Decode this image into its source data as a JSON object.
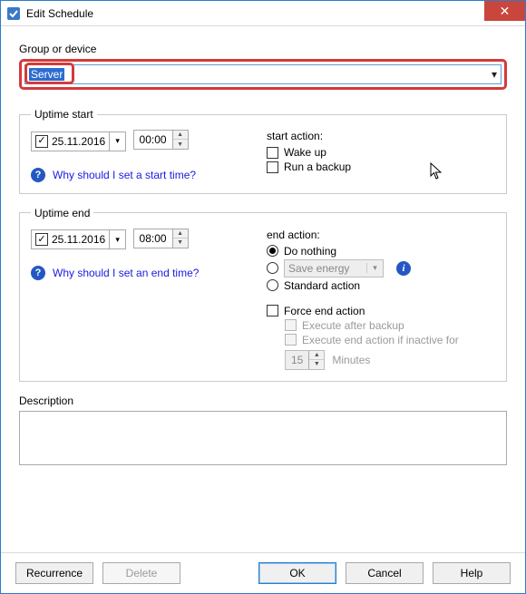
{
  "window": {
    "title": "Edit Schedule"
  },
  "groupdevice": {
    "label": "Group or device",
    "value": "Server"
  },
  "uptime_start": {
    "label": "Uptime start",
    "date": "25.11.2016",
    "time": "00:00",
    "date_enabled": true,
    "help": "Why should I set a start time?",
    "action_label": "start action:",
    "wake": "Wake up",
    "backup": "Run a backup"
  },
  "uptime_end": {
    "label": "Uptime end",
    "date": "25.11.2016",
    "time": "08:00",
    "date_enabled": true,
    "help": "Why should I set an end time?",
    "action_label": "end action:",
    "do_nothing": "Do nothing",
    "save_energy": "Save energy",
    "standard": "Standard action",
    "force": "Force end action",
    "exec_after": "Execute after backup",
    "exec_inactive": "Execute end action if inactive for",
    "minutes_value": "15",
    "minutes_label": "Minutes"
  },
  "description": {
    "label": "Description",
    "value": ""
  },
  "buttons": {
    "recurrence": "Recurrence",
    "delete": "Delete",
    "ok": "OK",
    "cancel": "Cancel",
    "help": "Help"
  }
}
